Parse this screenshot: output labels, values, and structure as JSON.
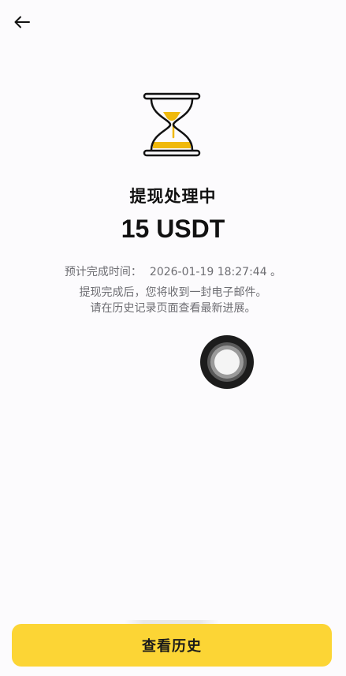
{
  "header": {
    "back_icon": "arrow-left-icon"
  },
  "status": {
    "icon": "hourglass-icon",
    "accent_color": "#F0B90B",
    "title": "提现处理中",
    "amount": "15 USDT"
  },
  "eta": {
    "label": "预计完成时间：",
    "value": "2026-01-19 18:27:44 。"
  },
  "note": {
    "line1": "提现完成后，您将收到一封电子邮件。",
    "line2": "请在历史记录页面查看最新进展。"
  },
  "overlay": {
    "icon": "assistive-touch-icon"
  },
  "footer": {
    "view_history_label": "查看历史",
    "button_color": "#FCD535"
  }
}
